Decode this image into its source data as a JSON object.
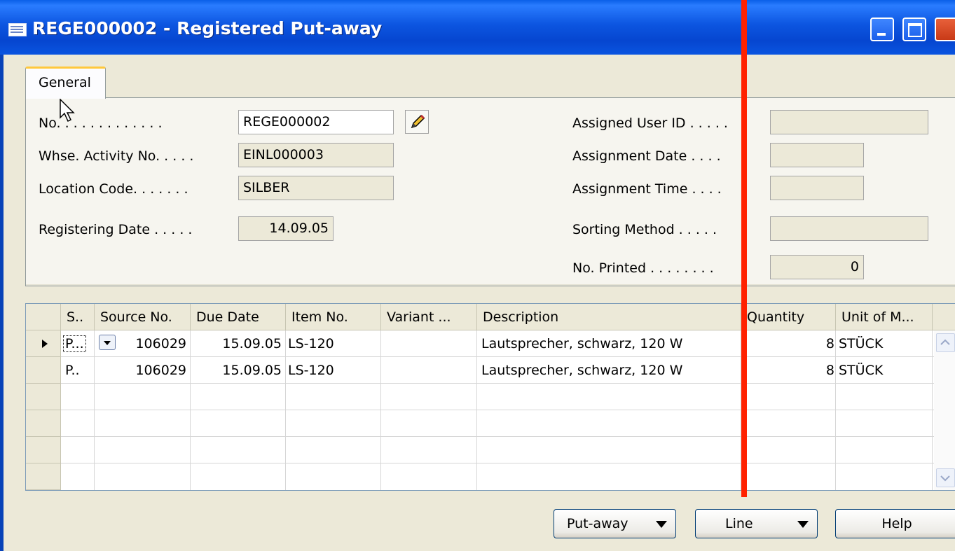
{
  "window": {
    "title": "REGE000002 - Registered Put-away",
    "icon": "form-icon"
  },
  "tabs": [
    {
      "label": "General",
      "active": true
    }
  ],
  "general": {
    "no": {
      "label": "No. . . . . . . . . . . . .",
      "value": "REGE000002"
    },
    "whse_activity_no": {
      "label": "Whse. Activity No. . . . .",
      "value": "EINL000003"
    },
    "location_code": {
      "label": "Location Code. . . . . . .",
      "value": "SILBER"
    },
    "registering_date": {
      "label": "Registering Date . . . . .",
      "value": "14.09.05"
    },
    "assigned_user_id": {
      "label": "Assigned User ID . . . . .",
      "value": ""
    },
    "assignment_date": {
      "label": "Assignment Date . . . .",
      "value": ""
    },
    "assignment_time": {
      "label": "Assignment Time . . . .",
      "value": ""
    },
    "sorting_method": {
      "label": "Sorting Method . . . . .",
      "value": ""
    },
    "no_printed": {
      "label": "No. Printed . . . . . . . .",
      "value": "0"
    }
  },
  "lines": {
    "columns": [
      "S..",
      "Source No.",
      "Due Date",
      "Item No.",
      "Variant ...",
      "Description",
      "Quantity",
      "Unit of M..."
    ],
    "rows": [
      {
        "s": "P...",
        "source_no": "106029",
        "due_date": "15.09.05",
        "item_no": "LS-120",
        "variant": "",
        "description": "Lautsprecher, schwarz, 120 W",
        "quantity": "8",
        "unit": "STÜCK"
      },
      {
        "s": "P..",
        "source_no": "106029",
        "due_date": "15.09.05",
        "item_no": "LS-120",
        "variant": "",
        "description": "Lautsprecher, schwarz, 120 W",
        "quantity": "8",
        "unit": "STÜCK"
      }
    ]
  },
  "buttons": {
    "put_away": "Put-away",
    "line": "Line",
    "help": "Help"
  },
  "colors": {
    "titlebar": "#0a55e0",
    "annotation_line": "#ff2200",
    "tab_accent": "#ffc83c"
  }
}
